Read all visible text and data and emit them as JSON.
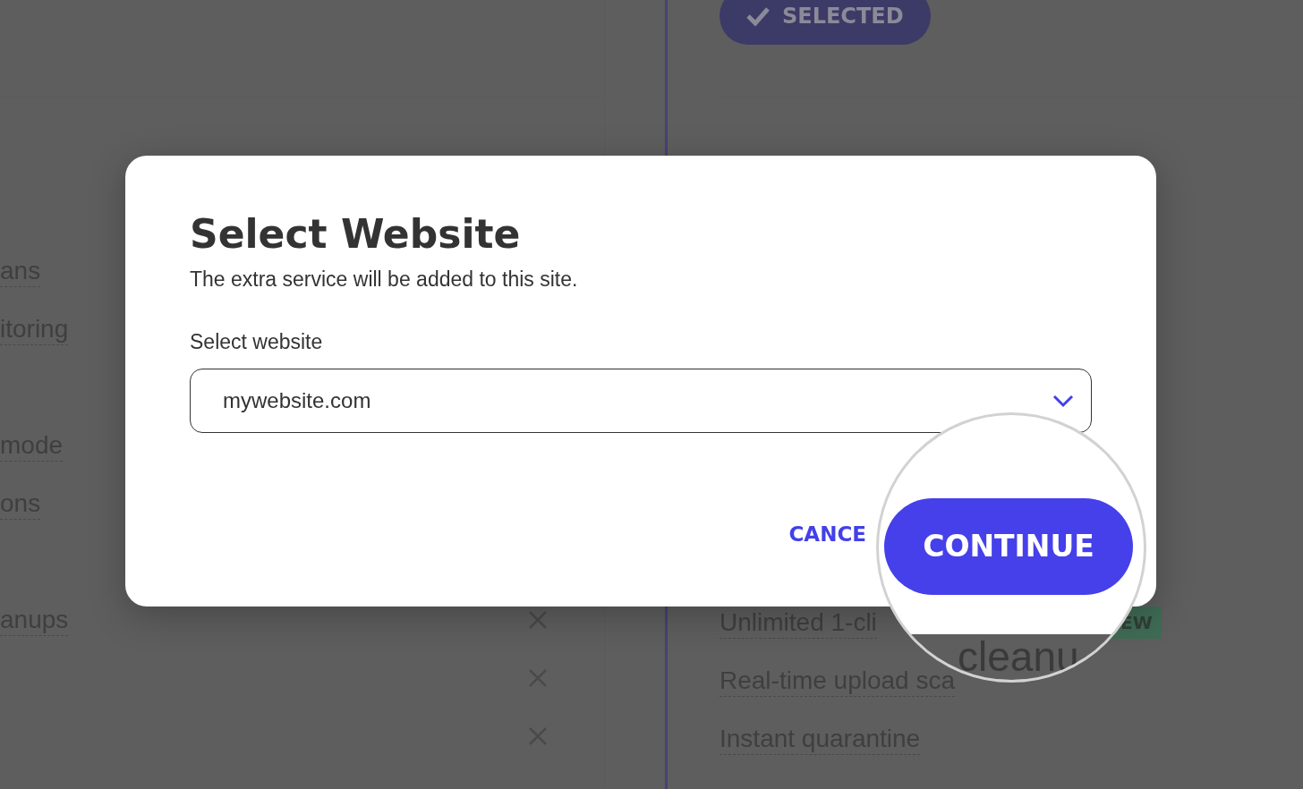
{
  "background": {
    "left_rows": [
      {
        "label": "ans"
      },
      {
        "label": "itoring"
      },
      {
        "kind": "blank"
      },
      {
        "label": "mode"
      },
      {
        "label": "ons"
      },
      {
        "kind": "blank"
      },
      {
        "label": "anups",
        "included": false
      },
      {
        "kind": "blank",
        "included": false
      },
      {
        "kind": "blank",
        "included": false
      }
    ],
    "selected_button": "SELECTED",
    "right_items": [
      {
        "label": "Unlimited 1-cli",
        "badge": "EW"
      },
      {
        "label": "Real-time upload sca"
      },
      {
        "label": "Instant quarantine"
      }
    ]
  },
  "dialog": {
    "title": "Select Website",
    "subtitle": "The extra service will be added to this site.",
    "field_label": "Select website",
    "select": {
      "value": "mywebsite.com"
    },
    "buttons": [
      {
        "label": "CANCE",
        "kind": "text"
      },
      {
        "label": "CONTINUE",
        "kind": "primary"
      }
    ]
  },
  "magnifier": {
    "text": "cleanu"
  }
}
